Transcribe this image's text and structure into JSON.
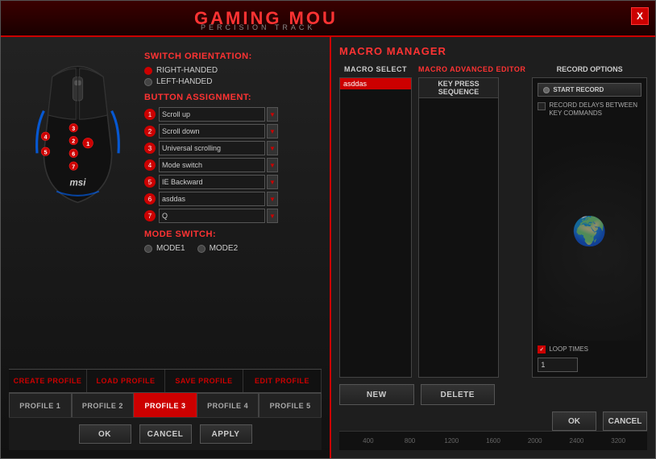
{
  "window": {
    "title": "GAMING MOU",
    "subtitle": "PERCISION TRACK",
    "close_label": "X"
  },
  "switch_orientation": {
    "title": "SWITCH ORIENTATION:",
    "options": [
      "RIGHT-HANDED",
      "LEFT-HANDED"
    ],
    "selected": "RIGHT-HANDED"
  },
  "button_assignment": {
    "title": "BUTTON ASSIGNMENT:",
    "buttons": [
      {
        "id": "1",
        "value": "Scroll up"
      },
      {
        "id": "2",
        "value": "Scroll down"
      },
      {
        "id": "3",
        "value": "Universal scrolling"
      },
      {
        "id": "4",
        "value": "Mode switch"
      },
      {
        "id": "5",
        "value": "IE Backward"
      },
      {
        "id": "6",
        "value": "asddas"
      },
      {
        "id": "7",
        "value": "Q"
      }
    ]
  },
  "mode_switch": {
    "title": "MODE SWITCH:",
    "options": [
      "MODE1",
      "MODE2"
    ]
  },
  "toolbar": {
    "create": "CREATE PROFILE",
    "load": "LOAD PROFILE",
    "save": "SAVE PROFILE",
    "edit": "EDIT PROFILE"
  },
  "profiles": [
    "PROFILE 1",
    "PROFILE 2",
    "PROFILE 3",
    "PROFILE 4",
    "PROFILE 5"
  ],
  "active_profile": "PROFILE 3",
  "bottom_buttons": {
    "ok": "OK",
    "cancel": "CANCEL",
    "apply": "APPLY"
  },
  "macro_manager": {
    "title": "MACRO MANAGER",
    "select_label": "MACRO SELECT",
    "editor_label": "MACRO ADVANCED EDITOR",
    "key_press_label": "KEY PRESS SEQUENCE",
    "record_options_label": "RECORD OPTIONS",
    "start_record": "START RECORD",
    "record_delays_label": "RECORD DELAYS BETWEEN KEY COMMANDS",
    "loop_times_label": "LOOP TIMES",
    "loop_value": "1",
    "new_btn": "NEW",
    "delete_btn": "DELETE",
    "ok_btn": "OK",
    "cancel_btn": "CANCEL",
    "macro_item": "asddas"
  },
  "timeline": {
    "ticks": [
      "400",
      "800",
      "1200",
      "1600",
      "2000",
      "2400",
      "3200"
    ]
  }
}
